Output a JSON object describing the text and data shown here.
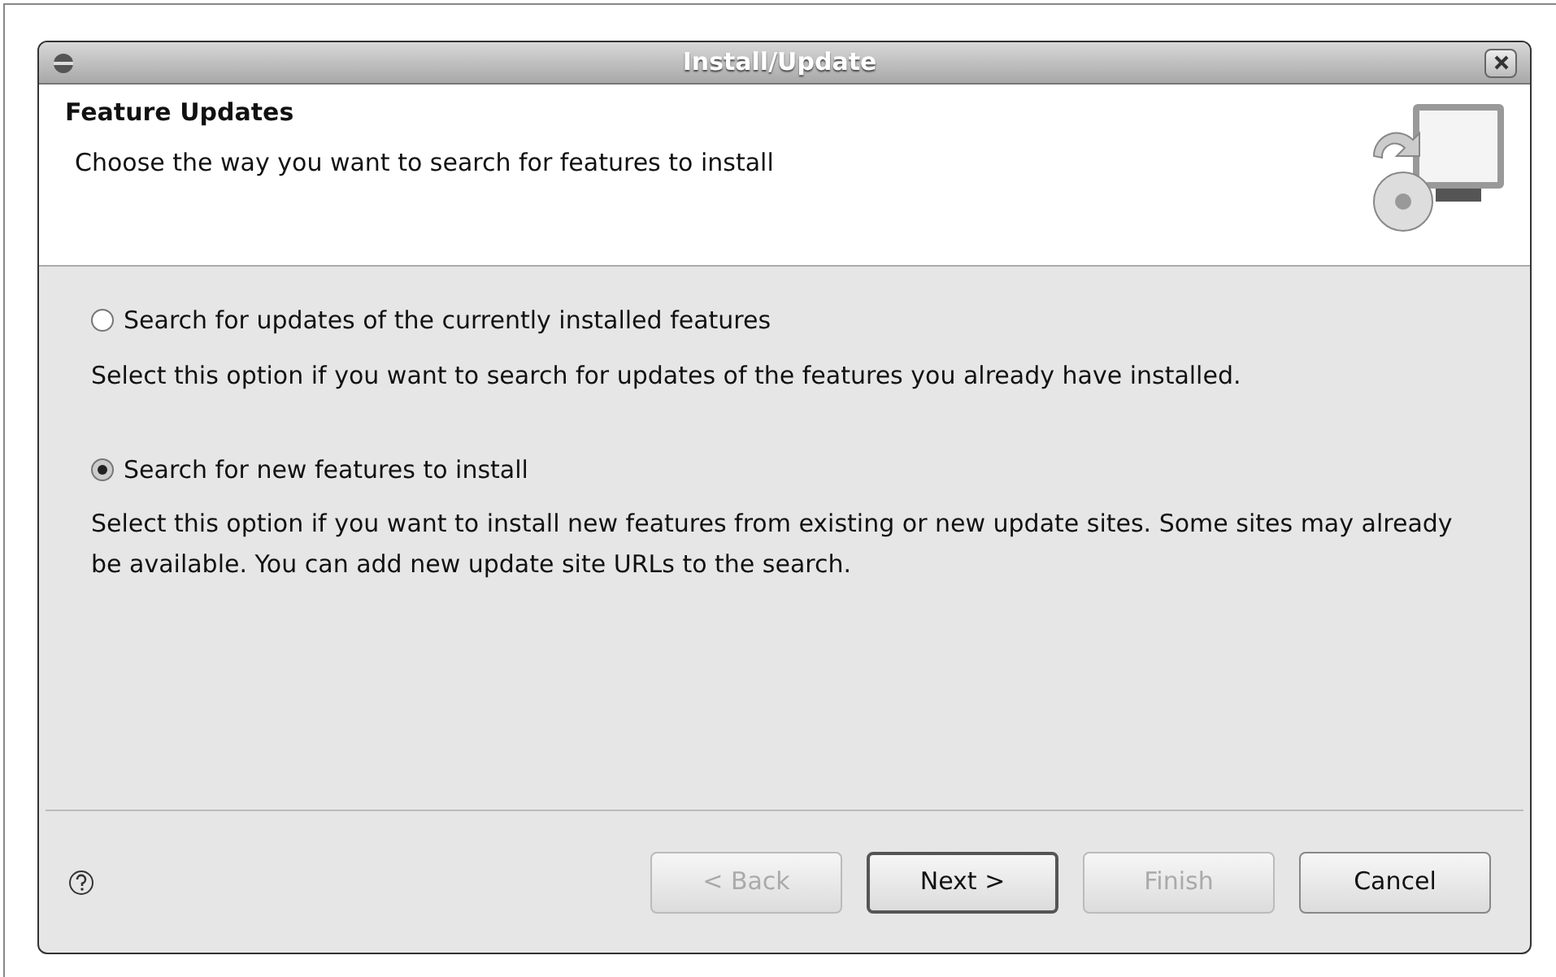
{
  "window": {
    "title": "Install/Update"
  },
  "header": {
    "title": "Feature Updates",
    "subtitle": "Choose the way you want to search for features to install"
  },
  "options": [
    {
      "label": "Search for updates of the currently installed features",
      "selected": false,
      "description": "Select this option if you want to search for updates of the features you already have installed."
    },
    {
      "label": "Search for new features to install",
      "selected": true,
      "description": "Select this option if you want to install new features from existing or new update sites. Some sites may already be available. You can add new update site URLs to the search."
    }
  ],
  "buttons": [
    {
      "label": "< Back",
      "disabled": true,
      "default": false
    },
    {
      "label": "Next >",
      "disabled": false,
      "default": true
    },
    {
      "label": "Finish",
      "disabled": true,
      "default": false
    },
    {
      "label": "Cancel",
      "disabled": false,
      "default": false
    }
  ]
}
